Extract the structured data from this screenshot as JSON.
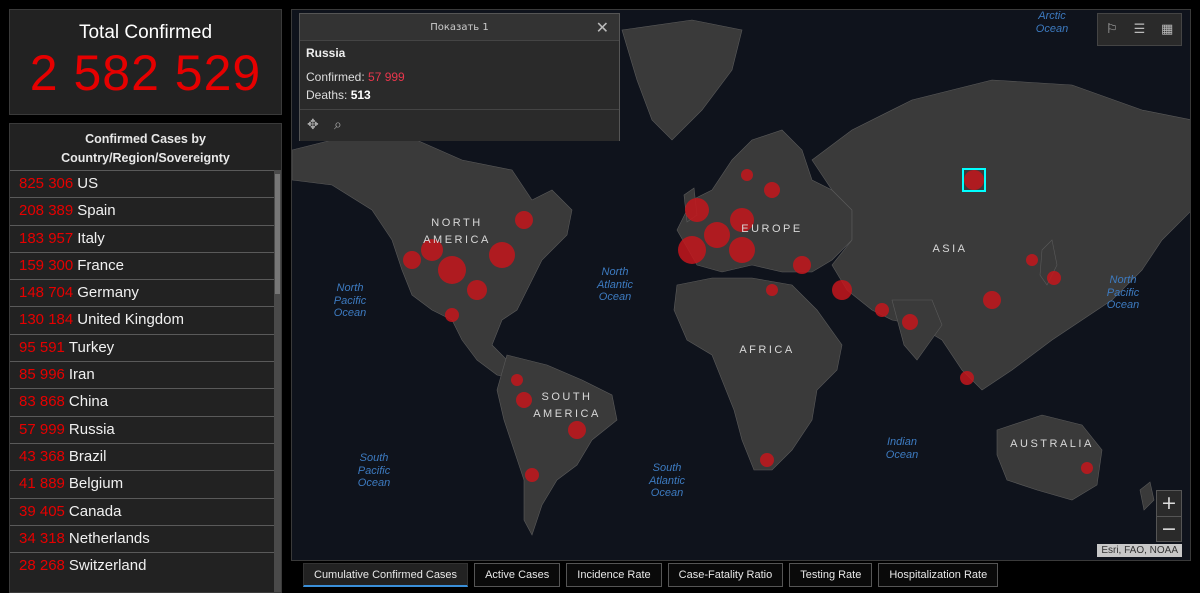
{
  "total": {
    "title": "Total Confirmed",
    "value": "2 582 529"
  },
  "country_list": {
    "title": "Confirmed Cases by Country/Region/Sovereignty",
    "items": [
      {
        "count": "825 306",
        "name": "US"
      },
      {
        "count": "208 389",
        "name": "Spain"
      },
      {
        "count": "183 957",
        "name": "Italy"
      },
      {
        "count": "159 300",
        "name": "France"
      },
      {
        "count": "148 704",
        "name": "Germany"
      },
      {
        "count": "130 184",
        "name": "United Kingdom"
      },
      {
        "count": "95 591",
        "name": "Turkey"
      },
      {
        "count": "85 996",
        "name": "Iran"
      },
      {
        "count": "83 868",
        "name": "China"
      },
      {
        "count": "57 999",
        "name": "Russia"
      },
      {
        "count": "43 368",
        "name": "Brazil"
      },
      {
        "count": "41 889",
        "name": "Belgium"
      },
      {
        "count": "39 405",
        "name": "Canada"
      },
      {
        "count": "34 318",
        "name": "Netherlands"
      },
      {
        "count": "28 268",
        "name": "Switzerland"
      }
    ]
  },
  "popup": {
    "header": "Показать 1",
    "close": "✕",
    "country": "Russia",
    "confirmed_label": "Confirmed:",
    "confirmed_value": "57 999",
    "deaths_label": "Deaths:",
    "deaths_value": "513",
    "move_icon": "✥",
    "zoom_icon": "⌕"
  },
  "map": {
    "oceans": {
      "arctic": "Arctic Ocean",
      "north_pacific": "North Pacific Ocean",
      "north_atlantic": "North Atlantic Ocean",
      "south_pacific": "South Pacific Ocean",
      "south_atlantic": "South Atlantic Ocean",
      "indian": "Indian Ocean",
      "north_pacific_east": "North Pacific Ocean"
    },
    "continents": {
      "north_america": "NORTH AMERICA",
      "south_america": "SOUTH AMERICA",
      "europe": "EUROPE",
      "africa": "AFRICA",
      "asia": "ASIA",
      "australia": "AUSTRALIA"
    },
    "attribution": "Esri, FAO, NOAA",
    "zoom_in": "+",
    "zoom_out": "−",
    "toolbar": {
      "bookmark_icon": "⚐",
      "list_icon": "☰",
      "qr_icon": "▦"
    },
    "colors": {
      "land": "#3a3a3a",
      "ocean": "#0f131c",
      "bubble": "#c4161c",
      "highlight": "#00ffff"
    }
  },
  "tabs": [
    {
      "label": "Cumulative Confirmed Cases",
      "active": true
    },
    {
      "label": "Active Cases",
      "active": false
    },
    {
      "label": "Incidence Rate",
      "active": false
    },
    {
      "label": "Case-Fatality Ratio",
      "active": false
    },
    {
      "label": "Testing Rate",
      "active": false
    },
    {
      "label": "Hospitalization Rate",
      "active": false
    }
  ]
}
